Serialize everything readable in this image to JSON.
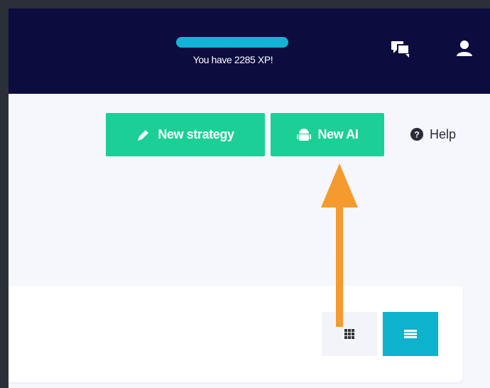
{
  "navbar": {
    "xp_text": "You have 2285 XP!",
    "xp_progress": 1.0,
    "icons": [
      "moon-icon",
      "chat-icon",
      "user-icon"
    ]
  },
  "toolbar": {
    "new_strategy_label": "New strategy",
    "new_ai_label": "New AI",
    "help_label": "Help"
  },
  "view_toggle": {
    "options": [
      "grid-view-icon",
      "list-view-icon"
    ],
    "active": "list"
  },
  "colors": {
    "navbar_bg": "#0c0c3f",
    "accent_green": "#1ccf97",
    "accent_cyan": "#0db2cd",
    "arrow": "#f59a2e"
  }
}
